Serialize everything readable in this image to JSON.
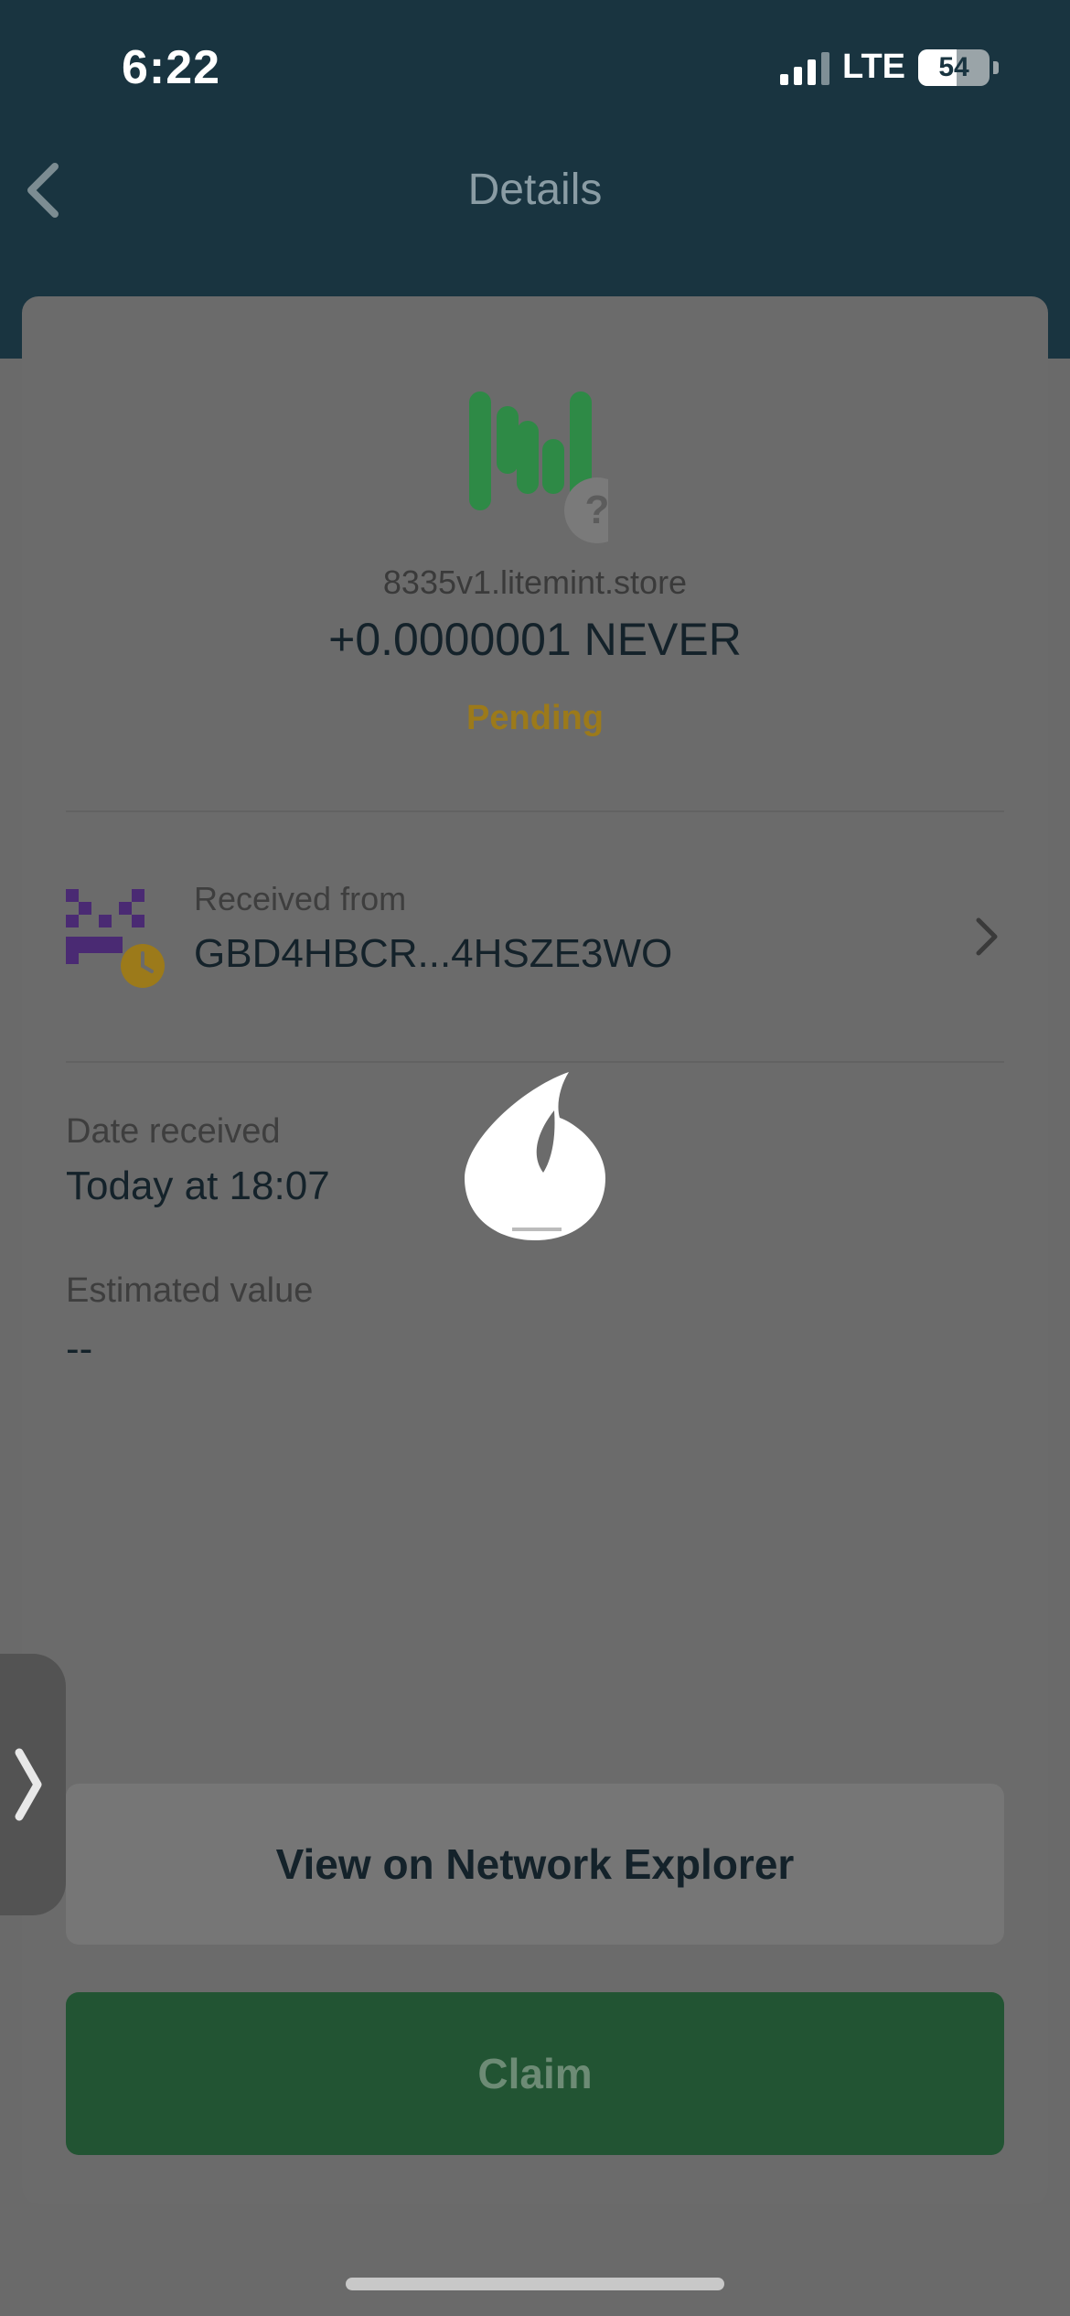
{
  "status_bar": {
    "time": "6:22",
    "network": "LTE",
    "battery": "54"
  },
  "nav": {
    "title": "Details",
    "back_icon": "chevron-left-icon"
  },
  "asset": {
    "logo_icon": "litemint-candle-logo",
    "badge_icon": "question-mark-icon",
    "domain": "8335v1.litemint.store",
    "amount": "+0.0000001 NEVER",
    "status": "Pending"
  },
  "sender": {
    "label": "Received from",
    "value": "GBD4HBCR...4HSZE3WO",
    "avatar_icon": "identicon-avatar",
    "clock_icon": "clock-icon",
    "chevron_icon": "chevron-right-icon"
  },
  "fields": [
    {
      "label": "Date received",
      "value": "Today at 18:07"
    },
    {
      "label": "Estimated value",
      "value": "--"
    }
  ],
  "overlay": {
    "loader_icon": "loading-drop-icon"
  },
  "side_tab": {
    "label": "❯"
  },
  "actions": {
    "explorer_label": "View on Network Explorer",
    "claim_label": "Claim"
  },
  "colors": {
    "header": "#193440",
    "pending": "#9c7a1a",
    "claim": "#225433",
    "logo_green": "#2e8a46",
    "avatar_purple": "#4a2a73"
  }
}
